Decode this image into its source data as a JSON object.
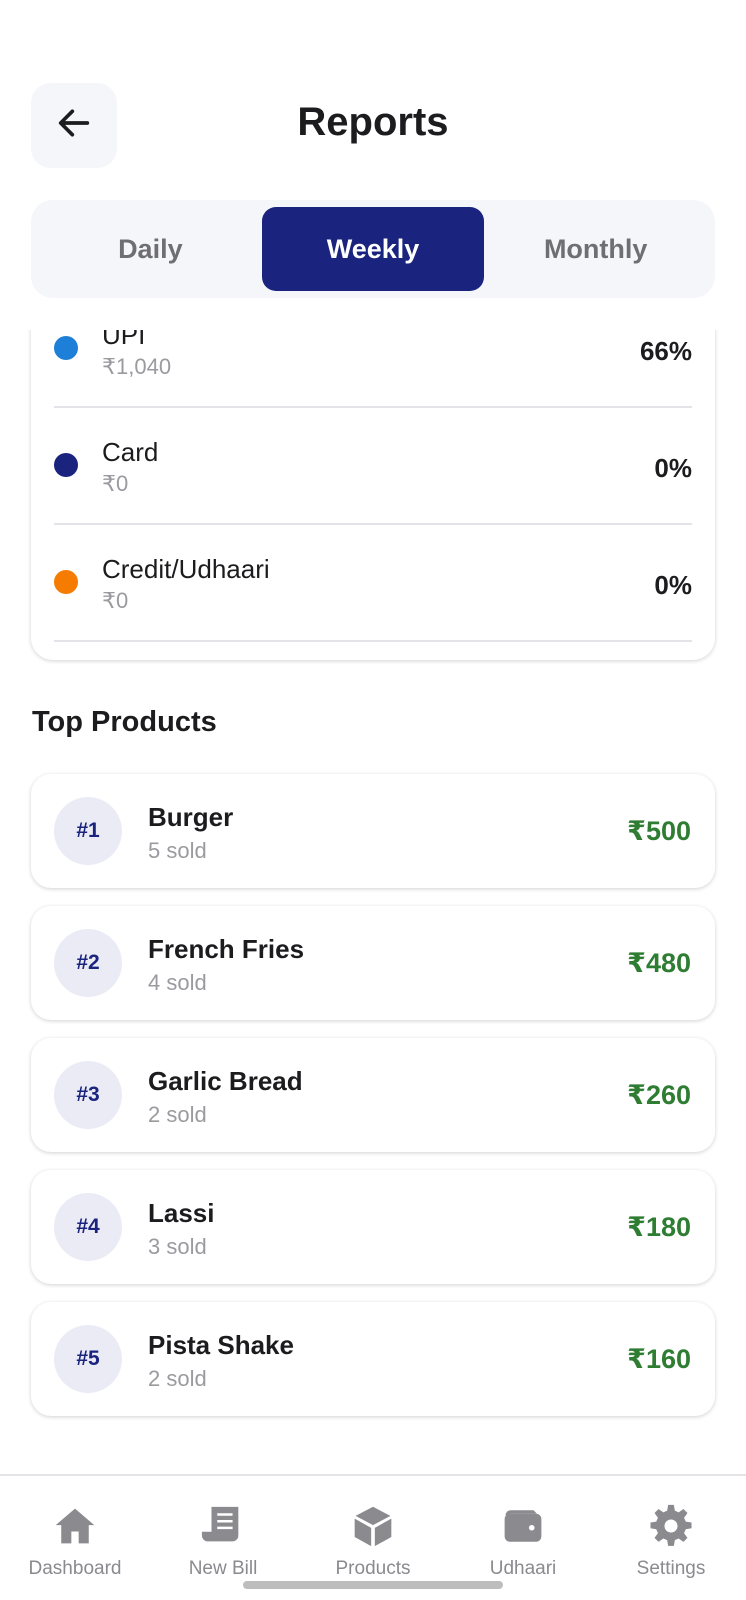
{
  "header": {
    "title": "Reports",
    "back_icon": "arrow-left-icon"
  },
  "tabs": [
    {
      "label": "Daily",
      "active": false
    },
    {
      "label": "Weekly",
      "active": true
    },
    {
      "label": "Monthly",
      "active": false
    }
  ],
  "payments": [
    {
      "name": "UPI",
      "amount": "₹1,040",
      "percent": "66%",
      "color": "#1e7fd8"
    },
    {
      "name": "Card",
      "amount": "₹0",
      "percent": "0%",
      "color": "#1a237e"
    },
    {
      "name": "Credit/Udhaari",
      "amount": "₹0",
      "percent": "0%",
      "color": "#f57c00"
    }
  ],
  "top_products": {
    "title": "Top Products",
    "items": [
      {
        "rank": "#1",
        "name": "Burger",
        "sold": "5 sold",
        "amount": "₹500"
      },
      {
        "rank": "#2",
        "name": "French Fries",
        "sold": "4 sold",
        "amount": "₹480"
      },
      {
        "rank": "#3",
        "name": "Garlic Bread",
        "sold": "2 sold",
        "amount": "₹260"
      },
      {
        "rank": "#4",
        "name": "Lassi",
        "sold": "3 sold",
        "amount": "₹180"
      },
      {
        "rank": "#5",
        "name": "Pista Shake",
        "sold": "2 sold",
        "amount": "₹160"
      }
    ]
  },
  "nav": [
    {
      "label": "Dashboard",
      "icon": "home-icon"
    },
    {
      "label": "New Bill",
      "icon": "receipt-icon"
    },
    {
      "label": "Products",
      "icon": "box-icon"
    },
    {
      "label": "Udhaari",
      "icon": "wallet-icon"
    },
    {
      "label": "Settings",
      "icon": "gear-icon"
    }
  ],
  "colors": {
    "primary": "#1a237e",
    "amount_green": "#2e7d32",
    "muted": "#9a9a9f"
  }
}
